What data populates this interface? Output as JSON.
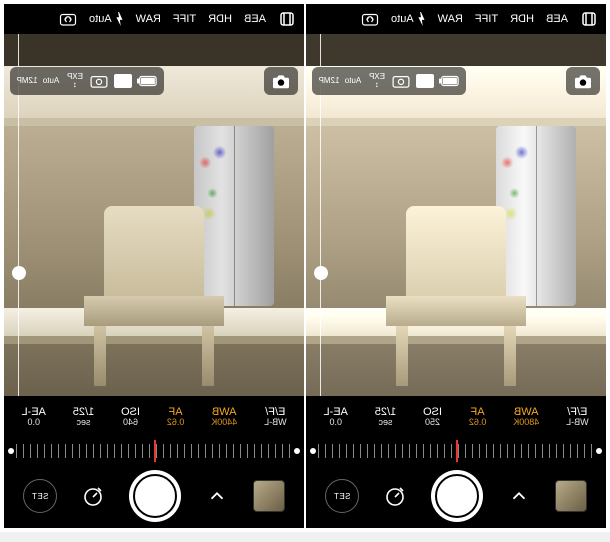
{
  "panes": [
    {
      "topbar": {
        "modes": [
          "AEB",
          "HDR",
          "TIFF",
          "RAW"
        ],
        "flash": "Auto"
      },
      "secondrow": {
        "res": "12MP",
        "auto": "Auto",
        "exp": "EXP"
      },
      "params": [
        {
          "value": "E/F/",
          "label": "WB-L",
          "color": "white"
        },
        {
          "value": "AWB",
          "label": "4400K",
          "color": "amber"
        },
        {
          "value": "AF",
          "label": "0.62",
          "color": "amber"
        },
        {
          "value": "ISO",
          "label": "640",
          "color": "white"
        },
        {
          "value": "1/25",
          "label": "sec",
          "color": "white"
        },
        {
          "value": "AE-L",
          "label": "0.0",
          "color": "white"
        }
      ],
      "set_label": "SET"
    },
    {
      "topbar": {
        "modes": [
          "AEB",
          "HDR",
          "TIFF",
          "RAW"
        ],
        "flash": "Auto"
      },
      "secondrow": {
        "res": "12MP",
        "auto": "Auto",
        "exp": "EXP"
      },
      "params": [
        {
          "value": "E/F/",
          "label": "WB-L",
          "color": "white"
        },
        {
          "value": "AWB",
          "label": "4800K",
          "color": "amber"
        },
        {
          "value": "AF",
          "label": "0.62",
          "color": "amber"
        },
        {
          "value": "ISO",
          "label": "250",
          "color": "white"
        },
        {
          "value": "1/25",
          "label": "sec",
          "color": "white"
        },
        {
          "value": "AE-L",
          "label": "0.0",
          "color": "white"
        }
      ],
      "set_label": "SET"
    }
  ]
}
